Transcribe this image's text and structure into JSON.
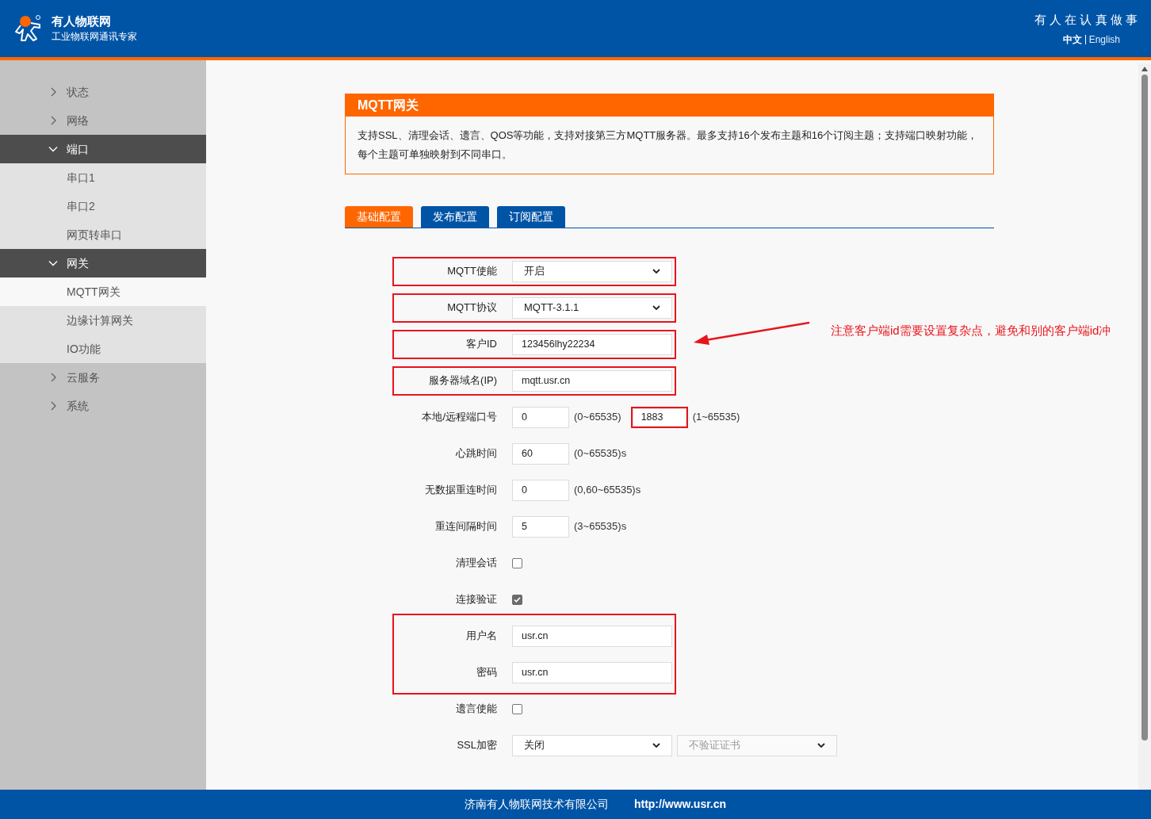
{
  "header": {
    "brand": "有人物联网",
    "tagline": "工业物联网通讯专家",
    "slogan": "有 人 在 认 真 做 事",
    "languages": [
      {
        "label": "中文",
        "selected": true
      },
      {
        "label": "English",
        "selected": false
      }
    ]
  },
  "sidebar": {
    "items": [
      {
        "label": "状态",
        "expanded": false
      },
      {
        "label": "网络",
        "expanded": false
      },
      {
        "label": "端口",
        "expanded": true,
        "children": [
          {
            "label": "串口1",
            "selected": false
          },
          {
            "label": "串口2",
            "selected": false
          },
          {
            "label": "网页转串口",
            "selected": false
          }
        ]
      },
      {
        "label": "网关",
        "expanded": true,
        "children": [
          {
            "label": "MQTT网关",
            "selected": true
          },
          {
            "label": "边缘计算网关",
            "selected": false
          },
          {
            "label": "IO功能",
            "selected": false
          }
        ]
      },
      {
        "label": "云服务",
        "expanded": false
      },
      {
        "label": "系统",
        "expanded": false
      }
    ]
  },
  "panel": {
    "title": "MQTT网关",
    "description": "支持SSL、清理会话、遗言、QOS等功能，支持对接第三方MQTT服务器。最多支持16个发布主题和16个订阅主题；支持端口映射功能，每个主题可单独映射到不同串口。"
  },
  "tabs": [
    {
      "label": "基础配置",
      "selected": true
    },
    {
      "label": "发布配置",
      "selected": false
    },
    {
      "label": "订阅配置",
      "selected": false
    }
  ],
  "form": [
    {
      "kind": "select",
      "label": "MQTT使能",
      "value": "开启",
      "annotated": true
    },
    {
      "kind": "select",
      "label": "MQTT协议",
      "value": "MQTT-3.1.1",
      "annotated": true
    },
    {
      "kind": "text",
      "label": "客户ID",
      "value": "123456lhy22234",
      "annotated": true
    },
    {
      "kind": "text",
      "label": "服务器域名(IP)",
      "value": "mqtt.usr.cn",
      "annotated": true
    },
    {
      "kind": "ports",
      "label": "本地/远程端口号",
      "fields": [
        {
          "value": "0",
          "range": "(0~65535)",
          "annotated": false
        },
        {
          "value": "1883",
          "range": "(1~65535)",
          "annotated": true
        }
      ]
    },
    {
      "kind": "short",
      "label": "心跳时间",
      "value": "60",
      "hint": "(0~65535)s"
    },
    {
      "kind": "short",
      "label": "无数据重连时间",
      "value": "0",
      "hint": "(0,60~65535)s"
    },
    {
      "kind": "short",
      "label": "重连间隔时间",
      "value": "5",
      "hint": "(3~65535)s"
    },
    {
      "kind": "checkbox",
      "label": "清理会话",
      "checked": false
    },
    {
      "kind": "checkbox",
      "label": "连接验证",
      "checked": true
    },
    {
      "kind": "group",
      "annotated": true,
      "rows": [
        {
          "kind": "text",
          "label": "用户名",
          "value": "usr.cn"
        },
        {
          "kind": "text",
          "label": "密码",
          "value": "usr.cn"
        }
      ]
    },
    {
      "kind": "checkbox",
      "label": "遗言使能",
      "checked": false
    },
    {
      "kind": "select_pair",
      "label": "SSL加密",
      "selects": [
        {
          "value": "关闭",
          "disabled": false
        },
        {
          "value": "不验证证书",
          "disabled": true
        }
      ]
    }
  ],
  "annotation": {
    "note": "注意客户端id需要设置复杂点，避免和别的客户端id冲"
  },
  "footer": {
    "company": "济南有人物联网技术有限公司",
    "url": "http://www.usr.cn"
  }
}
